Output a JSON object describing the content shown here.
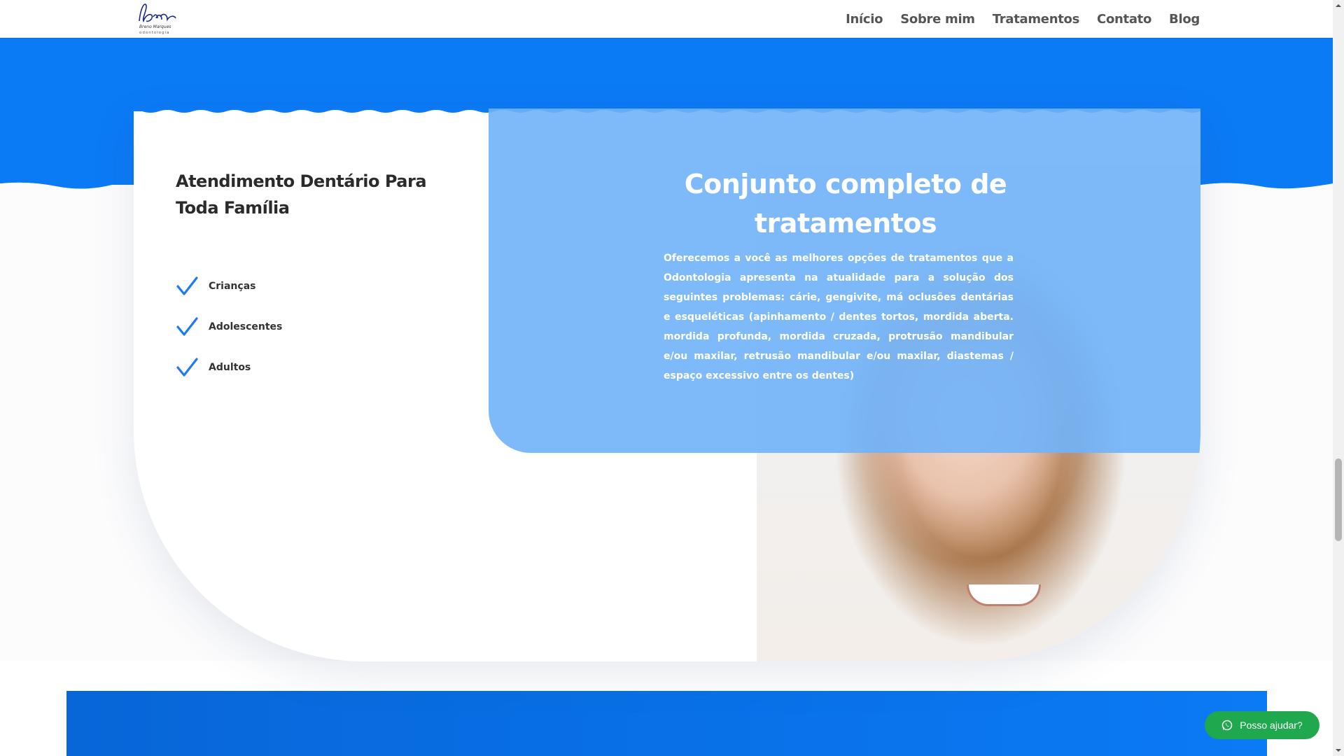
{
  "header": {
    "logo_alt": "Breno Marques odontologia",
    "nav": [
      {
        "label": "Início"
      },
      {
        "label": "Sobre mim"
      },
      {
        "label": "Tratamentos"
      },
      {
        "label": "Contato"
      },
      {
        "label": "Blog"
      }
    ]
  },
  "section": {
    "left_title": "Atendimento Dentário Para Toda Família",
    "items": [
      {
        "label": "Crianças",
        "icon": "check-icon"
      },
      {
        "label": "Adolescentes",
        "icon": "check-icon"
      },
      {
        "label": "Adultos",
        "icon": "check-icon"
      }
    ],
    "overlay_title": "Conjunto completo de tratamentos",
    "overlay_text": "Oferecemos a você as melhores opções de tratamentos que a Odontologia apresenta na atualidade para a solução dos seguintes problemas: cárie, gengivite, má oclusões dentárias e esqueléticas (apinhamento / dentes tortos, mordida aberta. mordida profunda, mordida cruzada, protrusão mandibular e/ou maxilar, retrusão mandibular e/ou maxilar, diastemas / espaço excessivo entre os dentes)"
  },
  "whatsapp": {
    "label": "Posso ajudar?",
    "icon": "whatsapp-icon"
  },
  "colors": {
    "brand_blue": "#0b7af5",
    "overlay_blue": "#70b2fa",
    "whatsapp_green": "#1fa84d"
  }
}
